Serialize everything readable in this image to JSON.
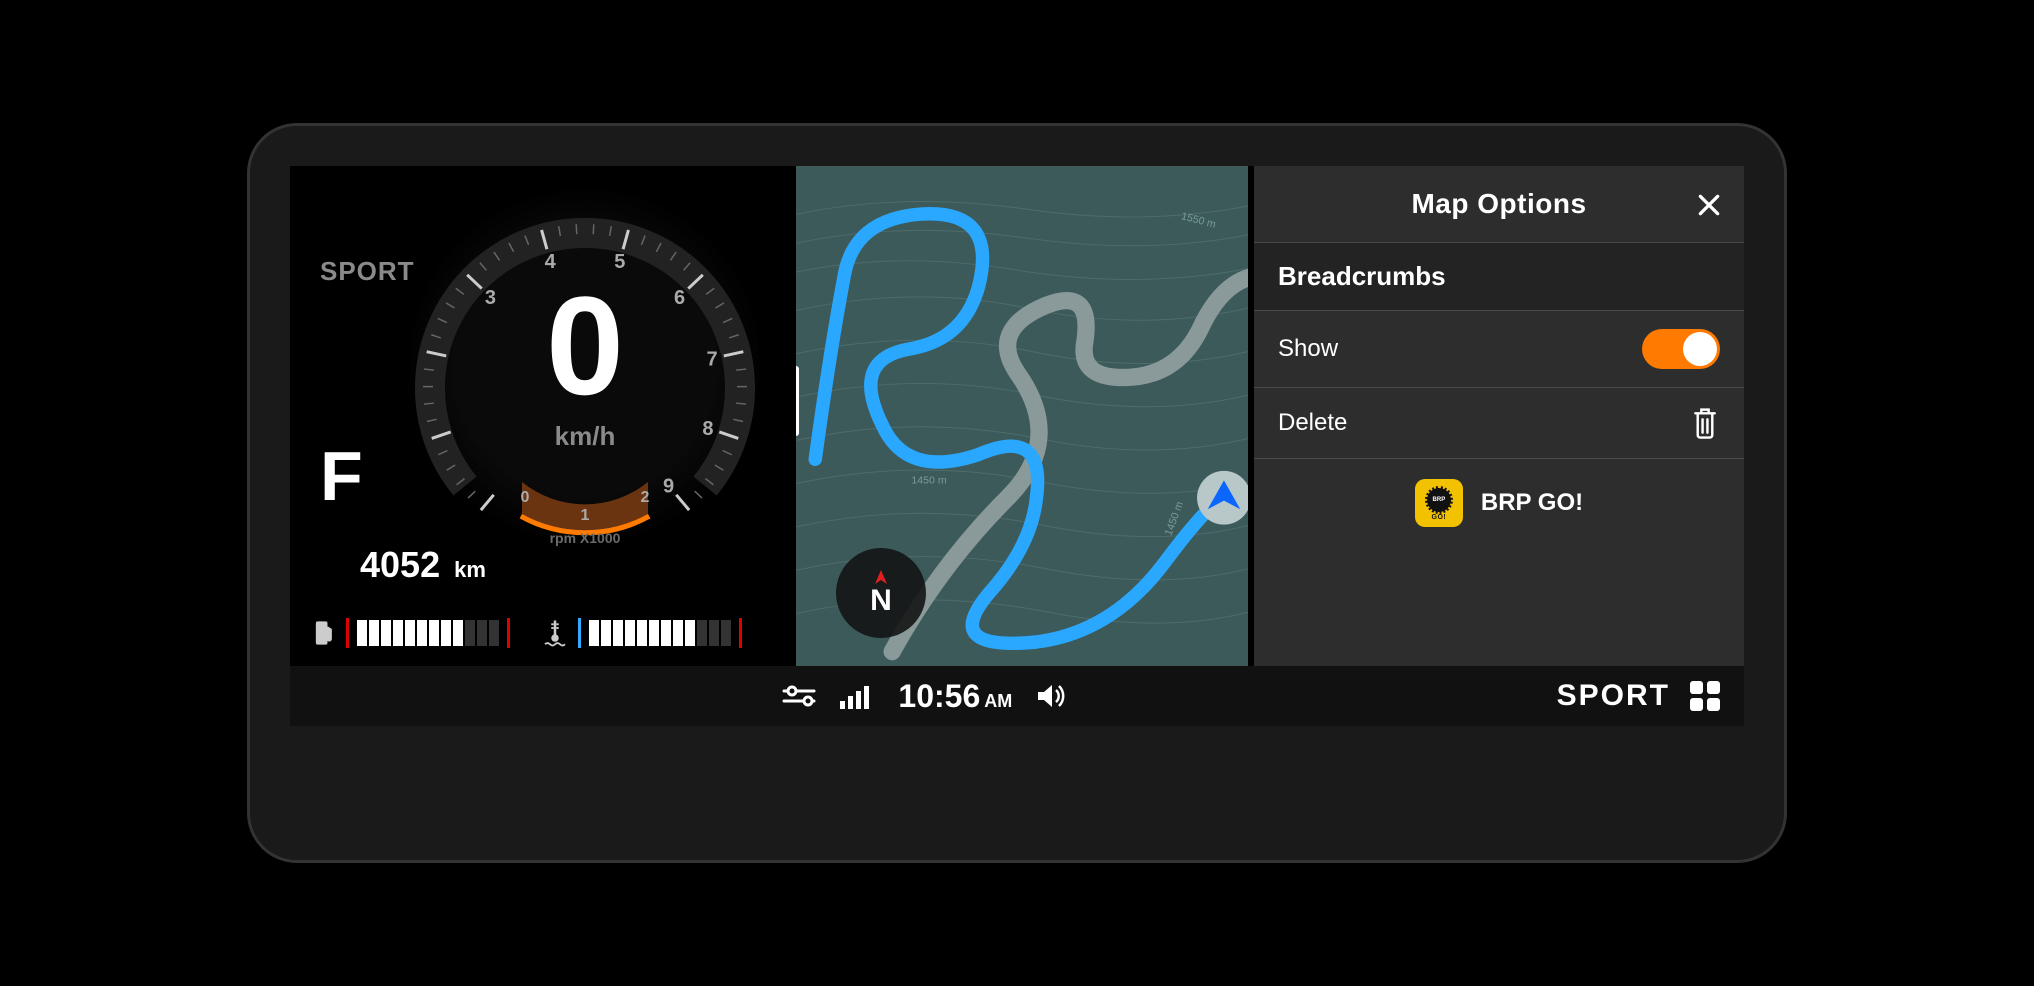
{
  "gauge": {
    "mode": "SPORT",
    "speed": "0",
    "speed_unit": "km/h",
    "gear": "F",
    "odometer": "4052",
    "odometer_unit": "km",
    "rpm_label": "rpm X1000",
    "tach_numbers": [
      "0",
      "1",
      "2",
      "3",
      "4",
      "5",
      "6",
      "7",
      "8",
      "9"
    ],
    "fuel_segments_on": 9,
    "fuel_segments_total": 12,
    "temp_segments_on": 9,
    "temp_segments_total": 12
  },
  "map": {
    "compass_letter": "N",
    "elevation_labels": [
      "1450 m",
      "1450 m",
      "1550 m"
    ]
  },
  "options": {
    "title": "Map Options",
    "section": "Breadcrumbs",
    "show_label": "Show",
    "show_enabled": true,
    "delete_label": "Delete",
    "app_label": "BRP GO!",
    "app_icon_brp": "BRP",
    "app_icon_go": "GO!"
  },
  "statusbar": {
    "time": "10:56",
    "ampm": "AM",
    "mode": "SPORT"
  }
}
